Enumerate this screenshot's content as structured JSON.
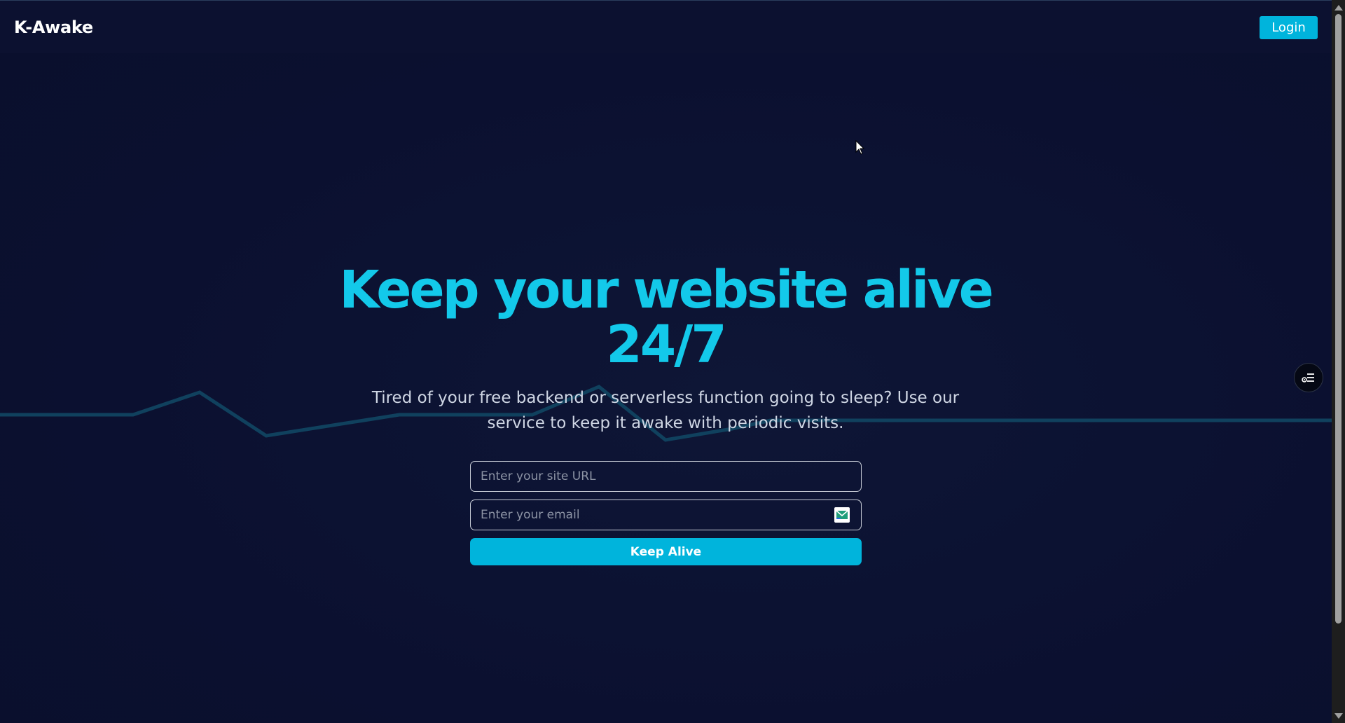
{
  "header": {
    "brand": "K-Awake",
    "login_label": "Login"
  },
  "hero": {
    "title_line1": "Keep your website alive",
    "title_line2": "24/7",
    "subtitle_line1": "Tired of your free backend or serverless function going to sleep? Use our",
    "subtitle_line2": "service to keep it awake with periodic visits."
  },
  "form": {
    "url_placeholder": "Enter your site URL",
    "url_value": "",
    "email_placeholder": "Enter your email",
    "email_value": "",
    "submit_label": "Keep Alive"
  },
  "icons": {
    "email_field_icon": "mail-icon",
    "floating_button_icon": "settings-list-icon"
  },
  "colors": {
    "background": "#0b1030",
    "accent": "#00b4dc",
    "title": "#13c9ea",
    "decor_line": "#10415e"
  }
}
